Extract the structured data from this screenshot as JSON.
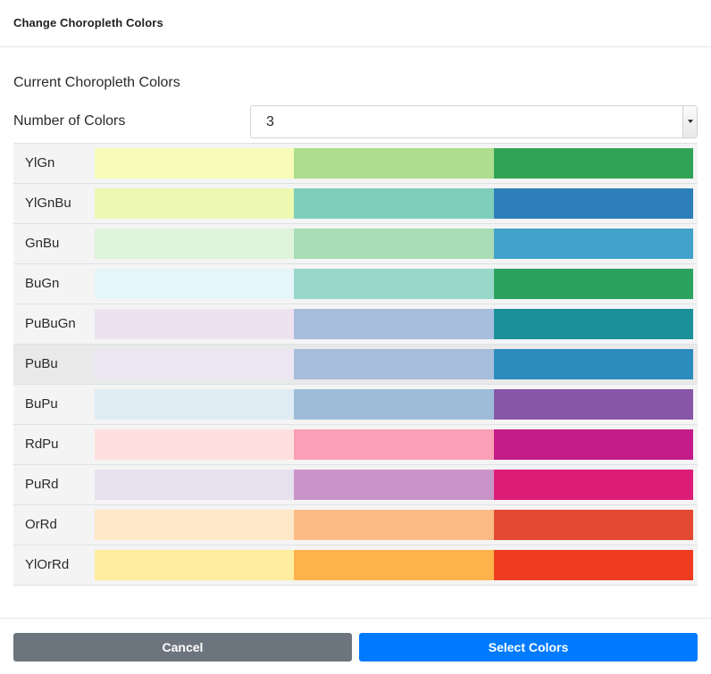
{
  "modal": {
    "title": "Change Choropleth Colors"
  },
  "current_label": "Current Choropleth Colors",
  "count": {
    "label": "Number of Colors",
    "value": "3"
  },
  "palettes": [
    {
      "name": "YlGn",
      "colors": [
        "#f7fcb9",
        "#addd8e",
        "#31a354"
      ]
    },
    {
      "name": "YlGnBu",
      "colors": [
        "#edf8b1",
        "#7fcdbb",
        "#2c7fb8"
      ]
    },
    {
      "name": "GnBu",
      "colors": [
        "#e0f3db",
        "#a8ddb5",
        "#43a2ca"
      ]
    },
    {
      "name": "BuGn",
      "colors": [
        "#e5f5f9",
        "#99d8c9",
        "#2ca25f"
      ]
    },
    {
      "name": "PuBuGn",
      "colors": [
        "#ece2f0",
        "#a6bddb",
        "#1c9099"
      ]
    },
    {
      "name": "PuBu",
      "colors": [
        "#ece7f2",
        "#a6bddb",
        "#2b8cbe"
      ]
    },
    {
      "name": "BuPu",
      "colors": [
        "#e0ecf4",
        "#9ebcda",
        "#8856a7"
      ]
    },
    {
      "name": "RdPu",
      "colors": [
        "#fde0dd",
        "#fa9fb5",
        "#c51b8a"
      ]
    },
    {
      "name": "PuRd",
      "colors": [
        "#e7e1ef",
        "#c994c7",
        "#dd1c77"
      ]
    },
    {
      "name": "OrRd",
      "colors": [
        "#fee8c8",
        "#fdbb84",
        "#e34a33"
      ]
    },
    {
      "name": "YlOrRd",
      "colors": [
        "#ffeda0",
        "#feb24c",
        "#f03b20"
      ]
    }
  ],
  "selected_palette": "PuBu",
  "footer": {
    "cancel_label": "Cancel",
    "select_label": "Select Colors"
  },
  "theme": {
    "cancel_color": "#6c757d",
    "primary_color": "#007bff"
  }
}
